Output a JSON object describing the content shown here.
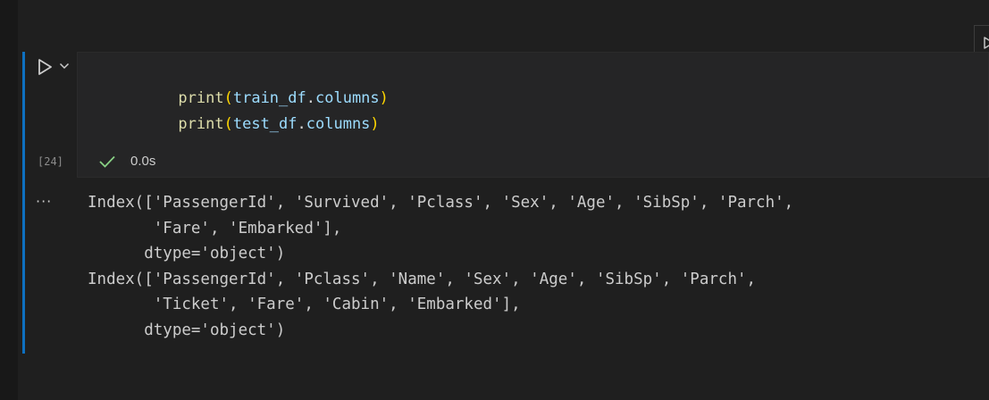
{
  "cell": {
    "execution_count": "[24]",
    "code_lines": [
      {
        "fn": "print",
        "open": "(",
        "obj": "train_df",
        "dot": ".",
        "attr": "columns",
        "close": ")"
      },
      {
        "fn": "print",
        "open": "(",
        "obj": "test_df",
        "dot": ".",
        "attr": "columns",
        "close": ")"
      }
    ],
    "status": {
      "icon": "checkmark-icon",
      "success_color": "#89d185",
      "time": "0.0s"
    }
  },
  "toolbar": {
    "run_icon": "play-icon",
    "options_icon": "chevron-down-icon"
  },
  "output": {
    "more_label": "···",
    "lines": [
      "Index(['PassengerId', 'Survived', 'Pclass', 'Sex', 'Age', 'SibSp', 'Parch',",
      "       'Fare', 'Embarked'],",
      "      dtype='object')",
      "Index(['PassengerId', 'Pclass', 'Name', 'Sex', 'Age', 'SibSp', 'Parch',",
      "       'Ticket', 'Fare', 'Cabin', 'Embarked'],",
      "      dtype='object')"
    ]
  },
  "colors": {
    "accent": "#0e70c0",
    "background": "#1f1f1f",
    "editor_background": "#252526"
  }
}
